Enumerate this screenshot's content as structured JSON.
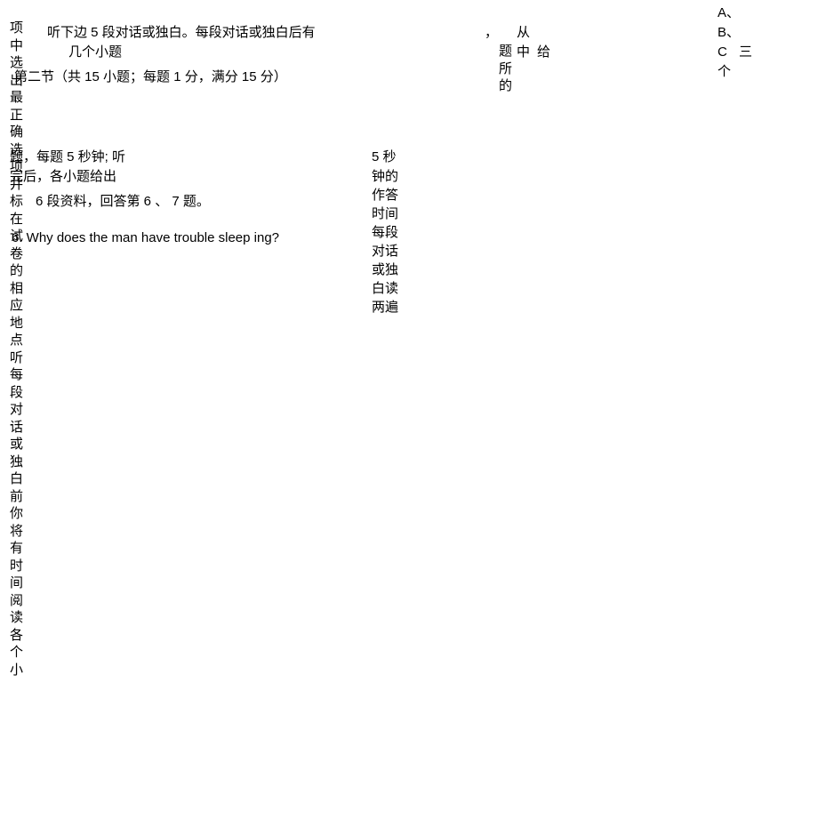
{
  "col1": {
    "vertical_left": "项中选出最正确选项并标在试卷的相应地点听每段对话或独白前你将有时间阅读各个小"
  },
  "main": {
    "line1_indent": "听下边 5 段对话或独白。每段对话或独白后有",
    "line2_indent": "几个小题",
    "section_header": "第二节（共 15 小题；每题 1 分，满分  15 分）",
    "line3": "题，每题 5 秒钟; 听",
    "line4": "完后，各小题给出",
    "line5_indent": "6 段资料，回答第  6 、  7 题。",
    "question6": "6. Why does the man have trouble sleep ing?"
  },
  "col_mid1": {
    "five_sec": "5 秒",
    "vertical_mid": "钟的作答时间每段对话或独白读两遍"
  },
  "col_mid2": {
    "comma": "，",
    "vertical": "题所的"
  },
  "col_mid3": {
    "line1": "从",
    "line2": "中",
    "line3": "给"
  },
  "col_right": {
    "optA": "A、",
    "optB": "B、",
    "optC": "C",
    "three": "三",
    "ge": "个"
  }
}
